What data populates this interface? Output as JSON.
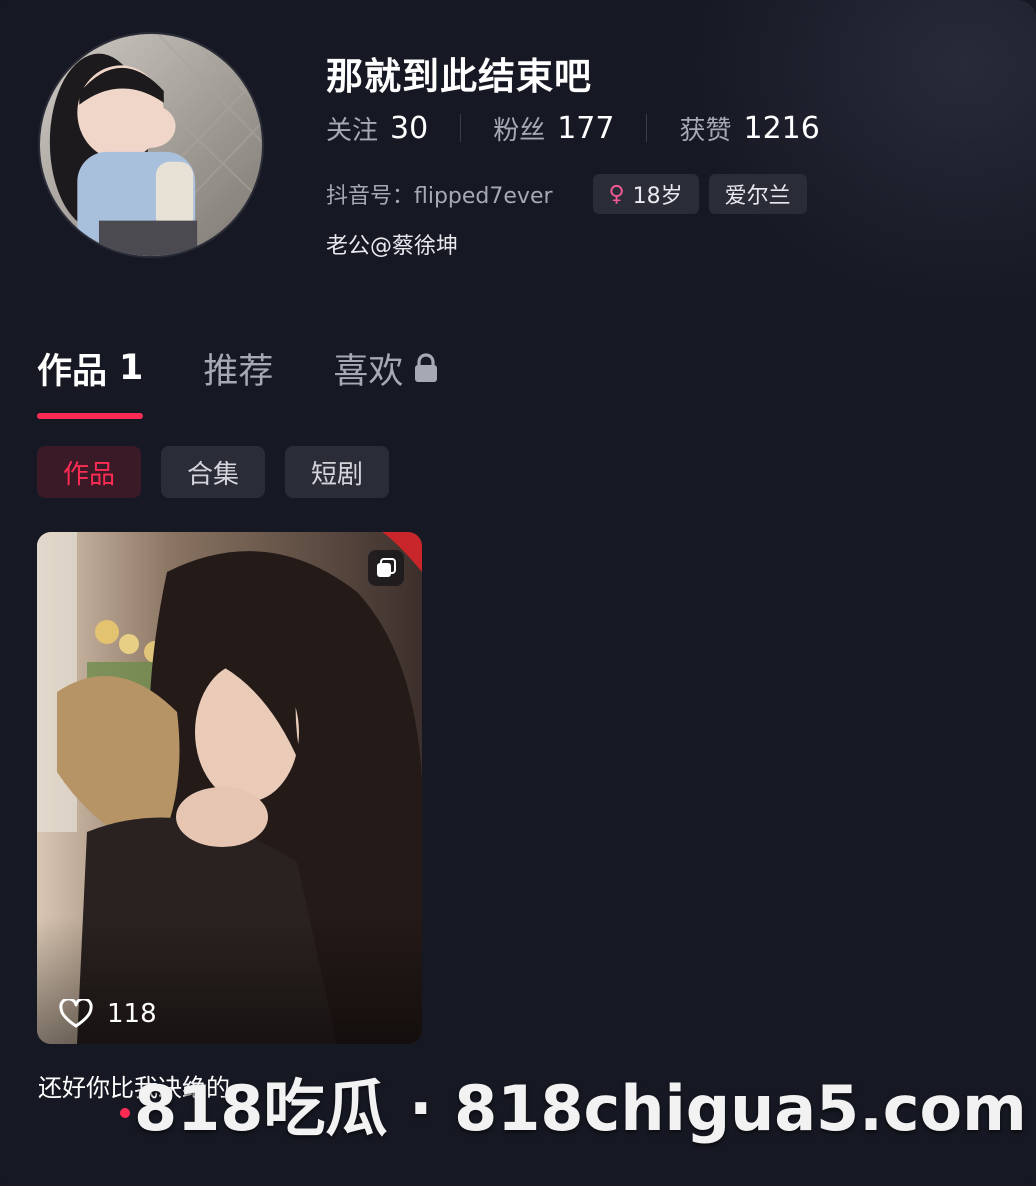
{
  "profile": {
    "nickname": "那就到此结束吧",
    "stats": [
      {
        "label": "关注",
        "value": "30"
      },
      {
        "label": "粉丝",
        "value": "177"
      },
      {
        "label": "获赞",
        "value": "1216"
      }
    ],
    "douyin_id": "抖音号：flipped7ever",
    "gender_symbol": "♀",
    "age": "18岁",
    "location": "爱尔兰",
    "signature": "老公@蔡徐坤"
  },
  "tabs": [
    {
      "label": "作品",
      "count": "1",
      "active": true
    },
    {
      "label": "推荐",
      "active": false
    },
    {
      "label": "喜欢",
      "locked": true,
      "active": false
    }
  ],
  "chips": [
    {
      "label": "作品",
      "active": true
    },
    {
      "label": "合集",
      "active": false
    },
    {
      "label": "短剧",
      "active": false
    }
  ],
  "video": {
    "likes": "118",
    "caption": "还好你比我决绝的"
  },
  "watermark": "818吃瓜 · 818chigua5.com",
  "icons": {
    "lock": "lock-icon",
    "heart": "heart-icon",
    "multi": "multi-image-icon",
    "gender": "female-icon"
  },
  "colors": {
    "background": "#161823",
    "accent": "#fe2c55",
    "muted_text": "#a6a8b3",
    "chip_bg": "#2a2c38",
    "gender_pink": "#f05a94"
  }
}
